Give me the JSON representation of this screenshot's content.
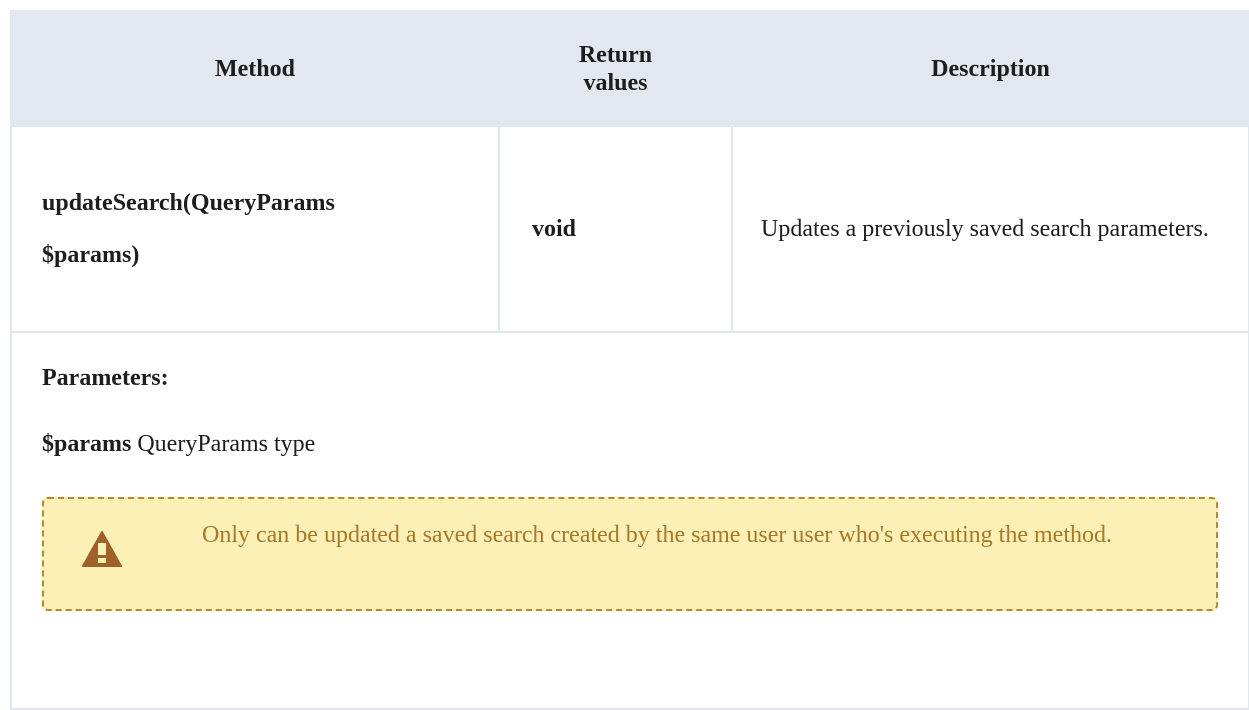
{
  "table": {
    "headers": {
      "method": "Method",
      "return_values": "Return values",
      "description": "Description"
    },
    "row": {
      "method_line1": "updateSearch(QueryParams",
      "method_line2": "$params)",
      "return_value": "void",
      "description": "Updates a previously saved search parameters."
    }
  },
  "details": {
    "parameters_heading": "Parameters:",
    "param": {
      "name": "$params",
      "type": "QueryParams type"
    },
    "warning": {
      "icon": "warning-triangle-icon",
      "text": "Only can be updated a saved search created by the same user user who's executing the method."
    }
  },
  "colors": {
    "header_bg": "#e3e8f0",
    "warning_bg": "#fcf0b7",
    "warning_text": "#a8782a",
    "warning_border": "#b38a2c",
    "warning_icon": "#a0602a"
  }
}
